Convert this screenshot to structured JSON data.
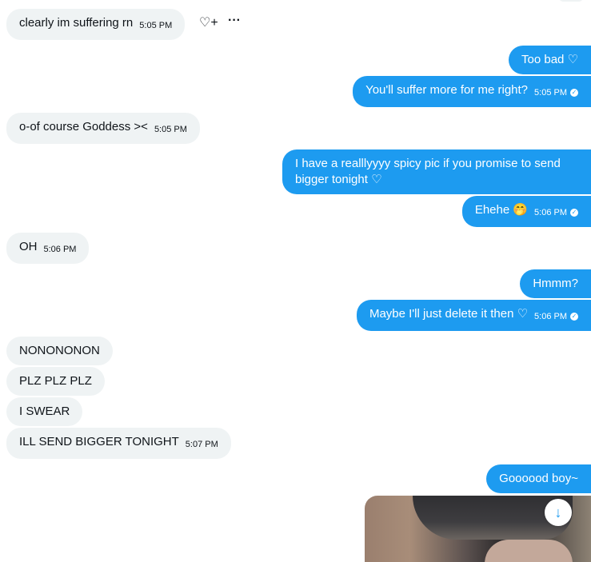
{
  "messages": [
    {
      "text": "clearly im suffering rn",
      "time": "5:05 PM"
    },
    {
      "text": "Too bad ♡"
    },
    {
      "text": "You'll suffer more for me right?",
      "time": "5:05 PM"
    },
    {
      "text": "o-of course Goddess ><",
      "time": "5:05 PM"
    },
    {
      "text_line1": "I have a realllyyyy spicy pic if you promise to send",
      "text_line2": "bigger tonight ♡"
    },
    {
      "text": "Ehehe 🤭",
      "time": "5:06 PM"
    },
    {
      "text": "OH",
      "time": "5:06 PM"
    },
    {
      "text": "Hmmm?"
    },
    {
      "text": "Maybe I'll just delete it then ♡",
      "time": "5:06 PM"
    },
    {
      "text": "NONONONON"
    },
    {
      "text": "PLZ PLZ PLZ"
    },
    {
      "text": "I SWEAR"
    },
    {
      "text": "ILL SEND BIGGER TONIGHT",
      "time": "5:07 PM"
    },
    {
      "text": "Goooood boy~"
    }
  ],
  "icons": {
    "react": "heart-plus-icon",
    "more": "more-icon",
    "read": "check-icon",
    "download": "download-icon"
  },
  "glyphs": {
    "react": "♡+",
    "more": "···",
    "check": "✓",
    "download": "↓"
  },
  "colors": {
    "outgoing": "#1d9bf0",
    "incoming": "#eff3f4"
  }
}
